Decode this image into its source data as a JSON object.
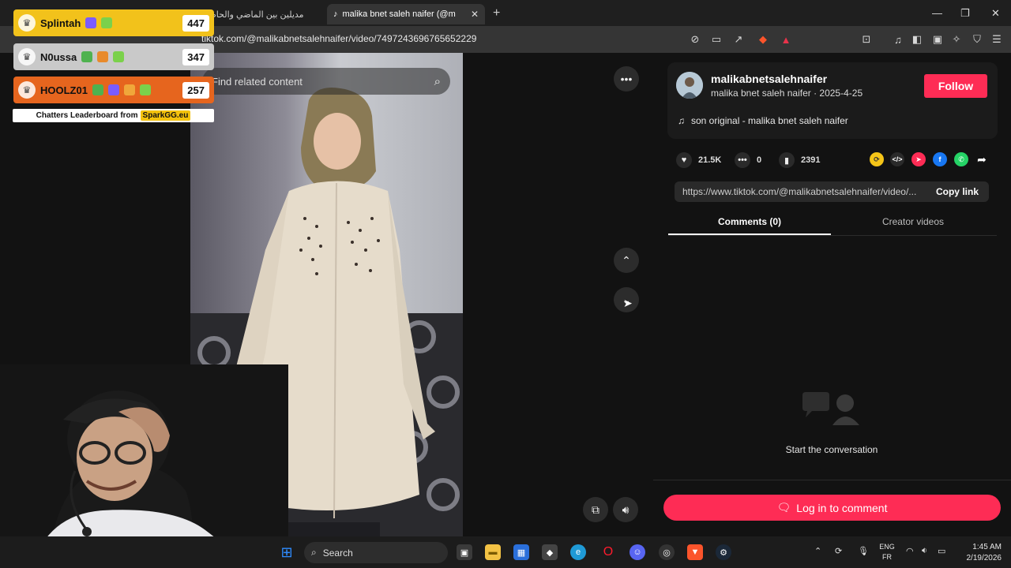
{
  "browser": {
    "tab_inactive_title": "مديلين بين الماضي والحاضر – حا",
    "tab_active_title": "malika bnet saleh naifer (@m",
    "url": "tiktok.com/@malikabnetsalehnaifer/video/7497243696765652229"
  },
  "leaderboard": {
    "entries": [
      {
        "name": "Splintah",
        "score": "447",
        "color": "#f2c21b"
      },
      {
        "name": "N0ussa",
        "score": "347",
        "color": "#c9c9c9"
      },
      {
        "name": "HOOLZ01",
        "score": "257",
        "color": "#e6651e"
      }
    ],
    "footer_prefix": "Chatters Leaderboard from",
    "footer_brand": "SparkGG.eu"
  },
  "video": {
    "search_placeholder": "Find related content"
  },
  "post": {
    "username": "malikabnetsalehnaifer",
    "nickname_date": "malika bnet saleh naifer · 2025-4-25",
    "follow_label": "Follow",
    "music": "son original - malika bnet saleh naifer",
    "likes": "21.5K",
    "comments": "0",
    "saves": "2391",
    "link": "https://www.tiktok.com/@malikabnetsalehnaifer/video/...",
    "copy_link_label": "Copy link",
    "tab_comments": "Comments (0)",
    "tab_creator": "Creator videos",
    "empty_text": "Start the conversation",
    "login_label": "Log in to comment"
  },
  "taskbar": {
    "search_label": "Search",
    "lang_line1": "ENG",
    "lang_line2": "FR",
    "time": "1:45 AM",
    "date": "2/19/2026"
  },
  "colors": {
    "accent": "#fe2c55",
    "panel_bg": "#121212"
  }
}
